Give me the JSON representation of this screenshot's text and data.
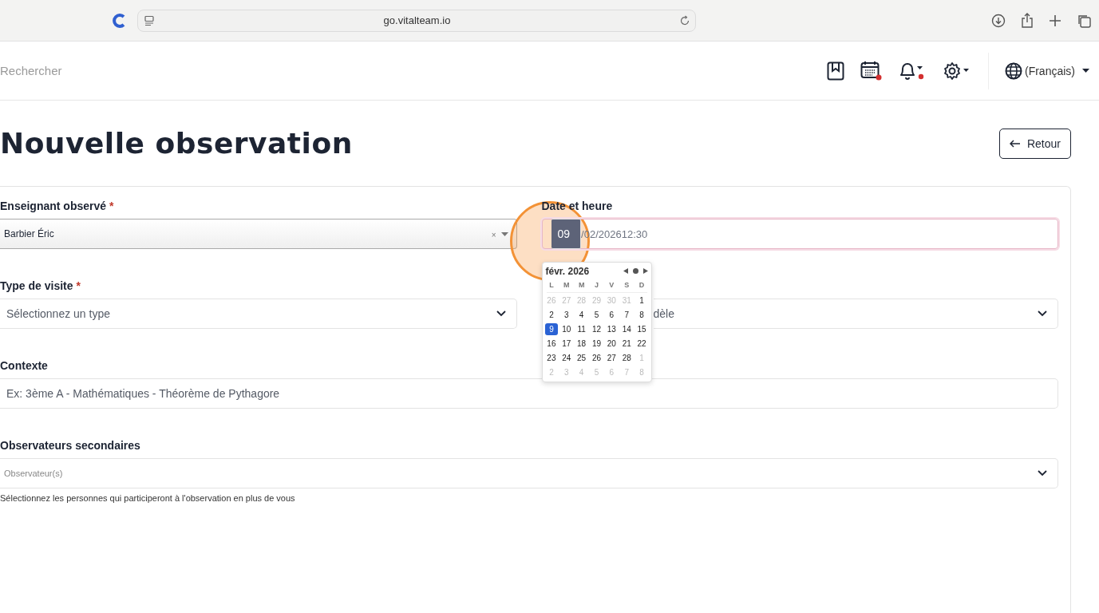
{
  "browser": {
    "url": "go.vitalteam.io"
  },
  "header": {
    "search_placeholder": "Rechercher",
    "language": "(Français)",
    "notifications": [
      {
        "kind": "calendar",
        "dot": true
      },
      {
        "kind": "bell",
        "dot": true
      }
    ]
  },
  "page": {
    "title": "Nouvelle observation",
    "back_button": "Retour"
  },
  "form": {
    "teacher": {
      "label": "Enseignant observé",
      "required_mark": "*",
      "value": "Barbier Éric",
      "clear": "×"
    },
    "date": {
      "label": "Date et heure",
      "focused": true,
      "segments": [
        {
          "text": "09",
          "selected": true
        },
        {
          "text": "/",
          "selected": false
        },
        {
          "text": "02",
          "selected": false
        },
        {
          "text": "/",
          "selected": false
        },
        {
          "text": "2026",
          "selected": false
        },
        {
          "text": "12",
          "selected": false
        },
        {
          "text": ":",
          "selected": false
        },
        {
          "text": "30",
          "selected": false
        }
      ]
    },
    "visit_type": {
      "label": "Type de visite",
      "required_mark": "*",
      "placeholder": "Sélectionnez un type"
    },
    "model": {
      "placeholder": "dèle"
    },
    "context": {
      "label": "Contexte",
      "placeholder": "Ex: 3ème A - Mathématiques - Théorème de Pythagore"
    },
    "observers": {
      "label": "Observateurs secondaires",
      "placeholder": "Observateur(s)",
      "help": "Sélectionnez les personnes qui participeront à l'observation en plus de vous"
    }
  },
  "calendar": {
    "month": "févr. 2026",
    "weekdays": [
      "L",
      "M",
      "M",
      "J",
      "V",
      "S",
      "D"
    ],
    "weeks": [
      [
        {
          "d": "26",
          "outside": true,
          "selected": false
        },
        {
          "d": "27",
          "outside": true,
          "selected": false
        },
        {
          "d": "28",
          "outside": true,
          "selected": false
        },
        {
          "d": "29",
          "outside": true,
          "selected": false
        },
        {
          "d": "30",
          "outside": true,
          "selected": false
        },
        {
          "d": "31",
          "outside": true,
          "selected": false
        },
        {
          "d": "1",
          "outside": false,
          "selected": false
        }
      ],
      [
        {
          "d": "2",
          "outside": false,
          "selected": false
        },
        {
          "d": "3",
          "outside": false,
          "selected": false
        },
        {
          "d": "4",
          "outside": false,
          "selected": false
        },
        {
          "d": "5",
          "outside": false,
          "selected": false
        },
        {
          "d": "6",
          "outside": false,
          "selected": false
        },
        {
          "d": "7",
          "outside": false,
          "selected": false
        },
        {
          "d": "8",
          "outside": false,
          "selected": false
        }
      ],
      [
        {
          "d": "9",
          "outside": false,
          "selected": true
        },
        {
          "d": "10",
          "outside": false,
          "selected": false
        },
        {
          "d": "11",
          "outside": false,
          "selected": false
        },
        {
          "d": "12",
          "outside": false,
          "selected": false
        },
        {
          "d": "13",
          "outside": false,
          "selected": false
        },
        {
          "d": "14",
          "outside": false,
          "selected": false
        },
        {
          "d": "15",
          "outside": false,
          "selected": false
        }
      ],
      [
        {
          "d": "16",
          "outside": false,
          "selected": false
        },
        {
          "d": "17",
          "outside": false,
          "selected": false
        },
        {
          "d": "18",
          "outside": false,
          "selected": false
        },
        {
          "d": "19",
          "outside": false,
          "selected": false
        },
        {
          "d": "20",
          "outside": false,
          "selected": false
        },
        {
          "d": "21",
          "outside": false,
          "selected": false
        },
        {
          "d": "22",
          "outside": false,
          "selected": false
        }
      ],
      [
        {
          "d": "23",
          "outside": false,
          "selected": false
        },
        {
          "d": "24",
          "outside": false,
          "selected": false
        },
        {
          "d": "25",
          "outside": false,
          "selected": false
        },
        {
          "d": "26",
          "outside": false,
          "selected": false
        },
        {
          "d": "27",
          "outside": false,
          "selected": false
        },
        {
          "d": "28",
          "outside": false,
          "selected": false
        },
        {
          "d": "1",
          "outside": true,
          "selected": false
        }
      ],
      [
        {
          "d": "2",
          "outside": true,
          "selected": false
        },
        {
          "d": "3",
          "outside": true,
          "selected": false
        },
        {
          "d": "4",
          "outside": true,
          "selected": false
        },
        {
          "d": "5",
          "outside": true,
          "selected": false
        },
        {
          "d": "6",
          "outside": true,
          "selected": false
        },
        {
          "d": "7",
          "outside": true,
          "selected": false
        },
        {
          "d": "8",
          "outside": true,
          "selected": false
        }
      ]
    ]
  },
  "click_highlight": true
}
